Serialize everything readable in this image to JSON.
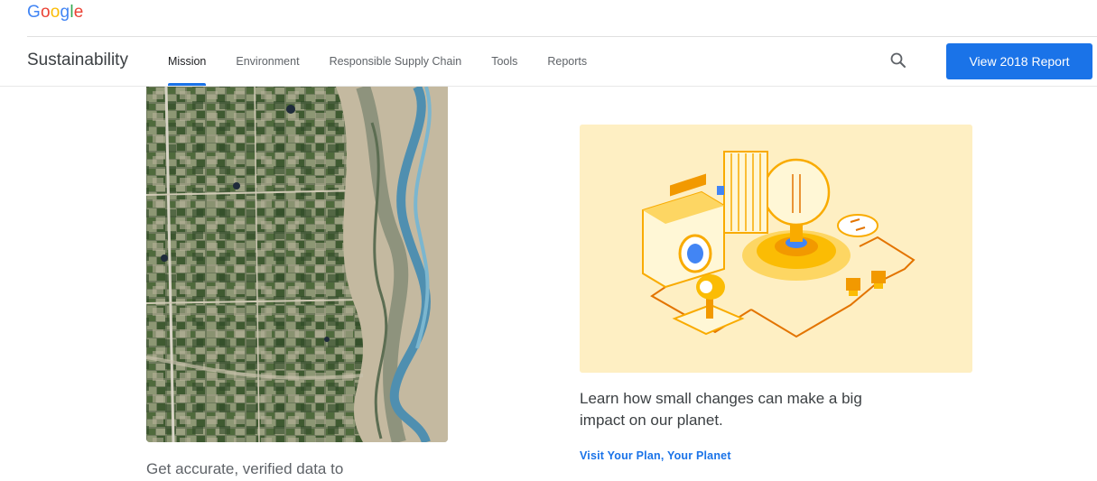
{
  "brand": {
    "logo_letters": [
      {
        "char": "G",
        "color": "#4285f4"
      },
      {
        "char": "o",
        "color": "#ea4335"
      },
      {
        "char": "o",
        "color": "#fbbc05"
      },
      {
        "char": "g",
        "color": "#4285f4"
      },
      {
        "char": "l",
        "color": "#34a853"
      },
      {
        "char": "e",
        "color": "#ea4335"
      }
    ]
  },
  "nav": {
    "site_title": "Sustainability",
    "tabs": [
      {
        "label": "Mission",
        "active": true
      },
      {
        "label": "Environment",
        "active": false
      },
      {
        "label": "Responsible Supply Chain",
        "active": false
      },
      {
        "label": "Tools",
        "active": false
      },
      {
        "label": "Reports",
        "active": false
      }
    ],
    "search_icon": "search-icon",
    "report_button_label": "View 2018 Report"
  },
  "cards": {
    "left": {
      "image": "satellite-farmland-river-image",
      "text": "Get accurate, verified data to"
    },
    "right": {
      "image": "home-energy-illustration",
      "text": "Learn how small changes can make a big impact on our planet.",
      "link_label": "Visit Your Plan, Your Planet"
    }
  },
  "colors": {
    "accent": "#1a73e8",
    "illustration_bg": "#feefc3"
  }
}
